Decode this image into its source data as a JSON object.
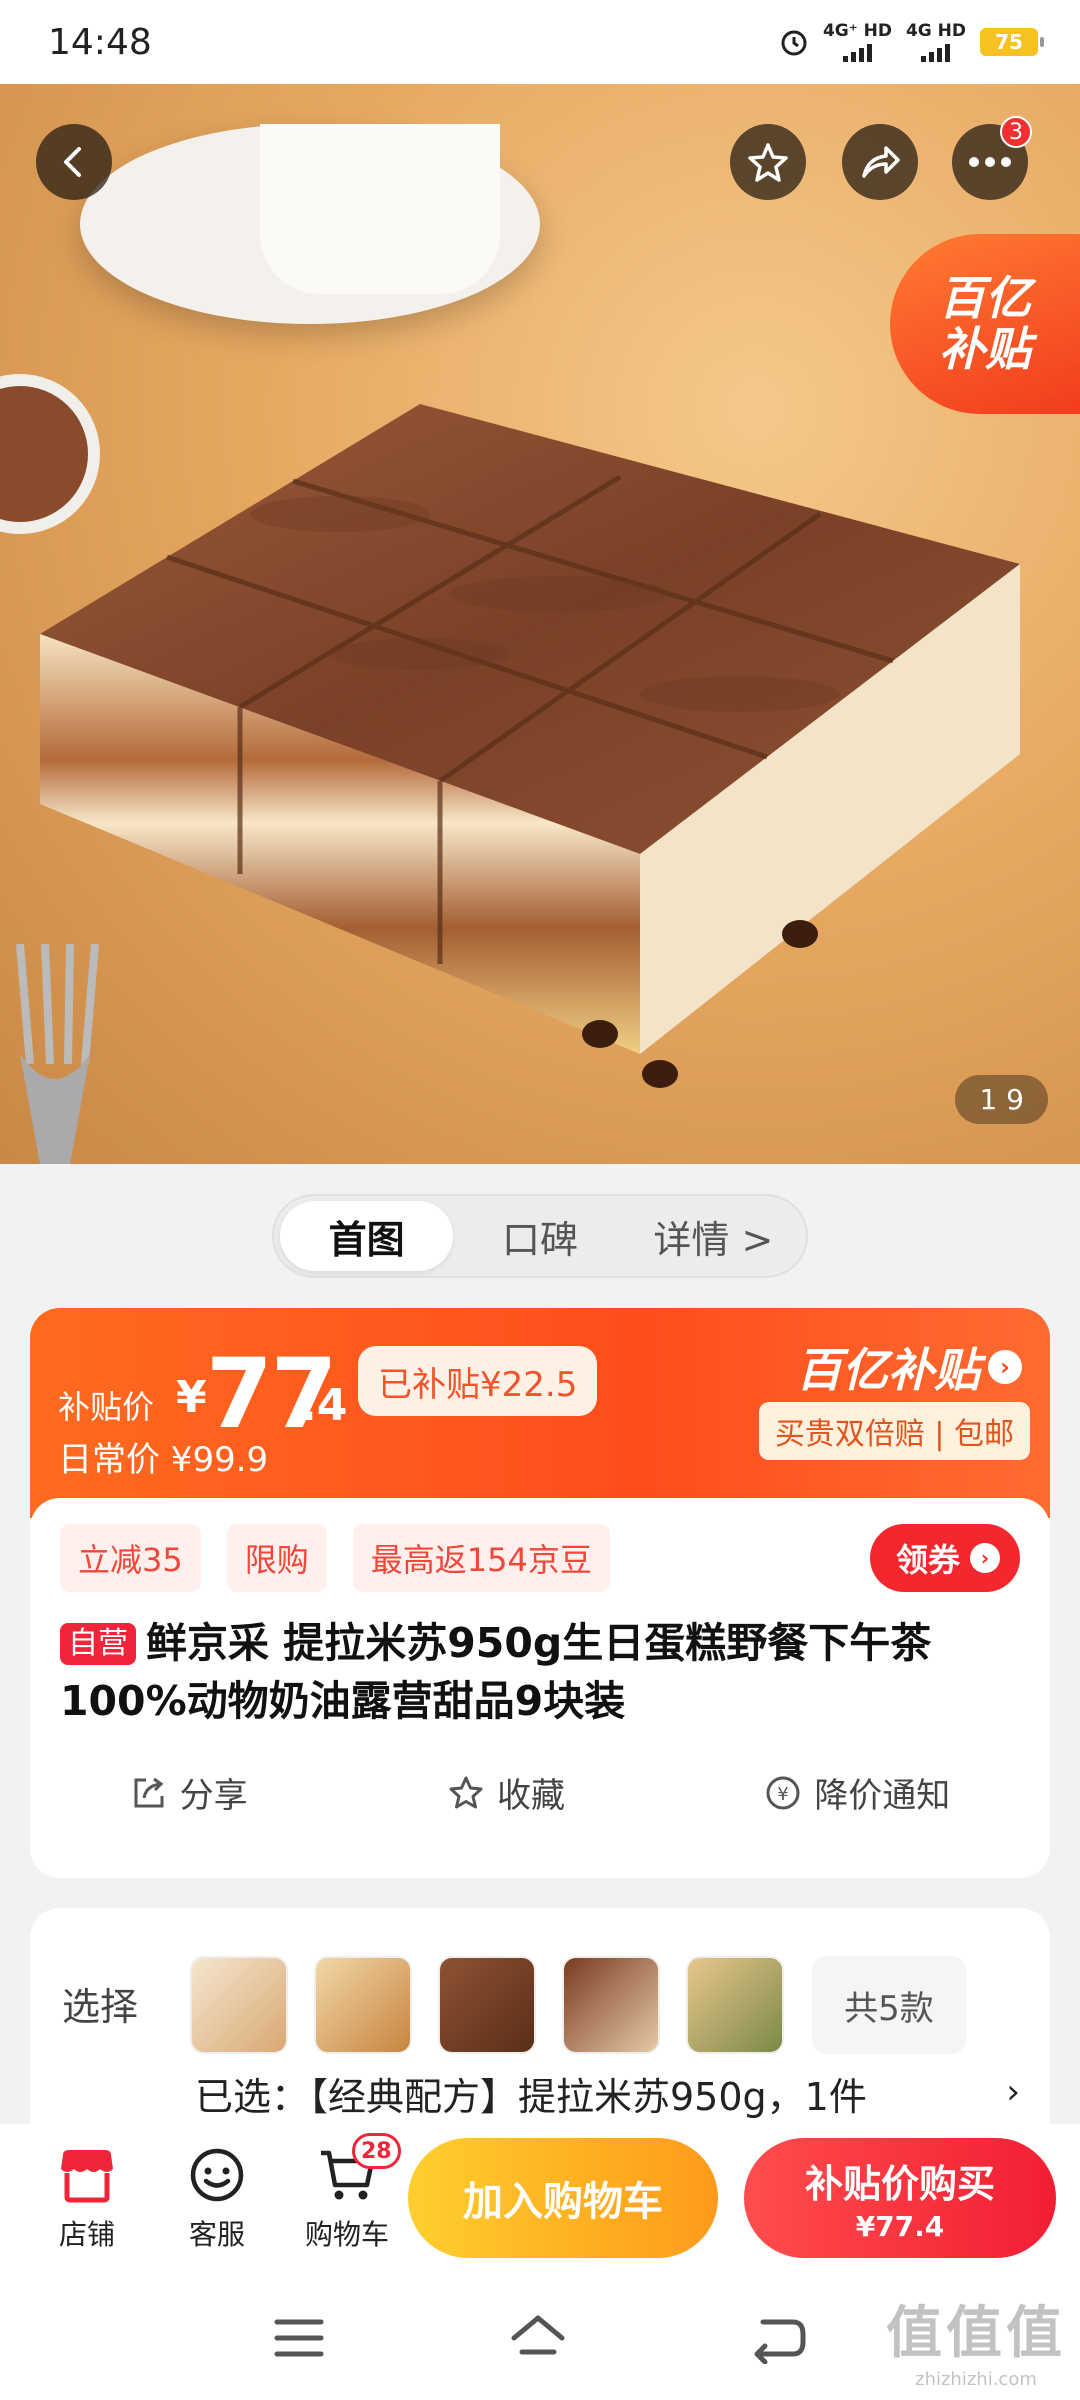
{
  "status_bar": {
    "time": "14:48",
    "network_1": "4G⁺ HD",
    "network_2": "4G HD",
    "battery": "75"
  },
  "hero": {
    "image_counter": "1  9",
    "more_badge": "3",
    "subsidy_badge_line1": "百亿",
    "subsidy_badge_line2": "补贴"
  },
  "tabs": [
    {
      "label": "首图"
    },
    {
      "label": "口碑"
    },
    {
      "label": "详情 >"
    }
  ],
  "price": {
    "subsidy_label": "补贴价",
    "currency": "¥",
    "integer": "77",
    "decimal": ".4",
    "saved": "已补贴¥22.5",
    "daily_price": "日常价 ¥99.9",
    "program_name": "百亿补贴",
    "guarantee": "买贵双倍赔 | 包邮"
  },
  "promos": {
    "chips": [
      "立减35",
      "限购",
      "最高返154京豆"
    ],
    "coupon_label": "领券"
  },
  "product": {
    "self_operated": "自营",
    "title": "鲜京采 提拉米苏950g生日蛋糕野餐下午茶 100%动物奶油露营甜品9块装"
  },
  "actions": {
    "share": "分享",
    "favorite": "收藏",
    "price_alert": "降价通知"
  },
  "selection": {
    "label": "选择",
    "total": "共5款",
    "selected": "已选：【经典配方】提拉米苏950g，1件",
    "arrow": "›"
  },
  "bottom_bar": {
    "shop": "店铺",
    "service": "客服",
    "cart": "购物车",
    "cart_count": "28",
    "add_to_cart": "加入购物车",
    "buy_label": "补贴价购买",
    "buy_price": "¥77.4"
  },
  "watermark": {
    "main": "值值值",
    "sub": "zhizhizhi.com"
  },
  "colors": {
    "accent_red": "#f23030",
    "subsidy_orange": "#ff5a1f",
    "cart_yellow": "#ffb323"
  }
}
